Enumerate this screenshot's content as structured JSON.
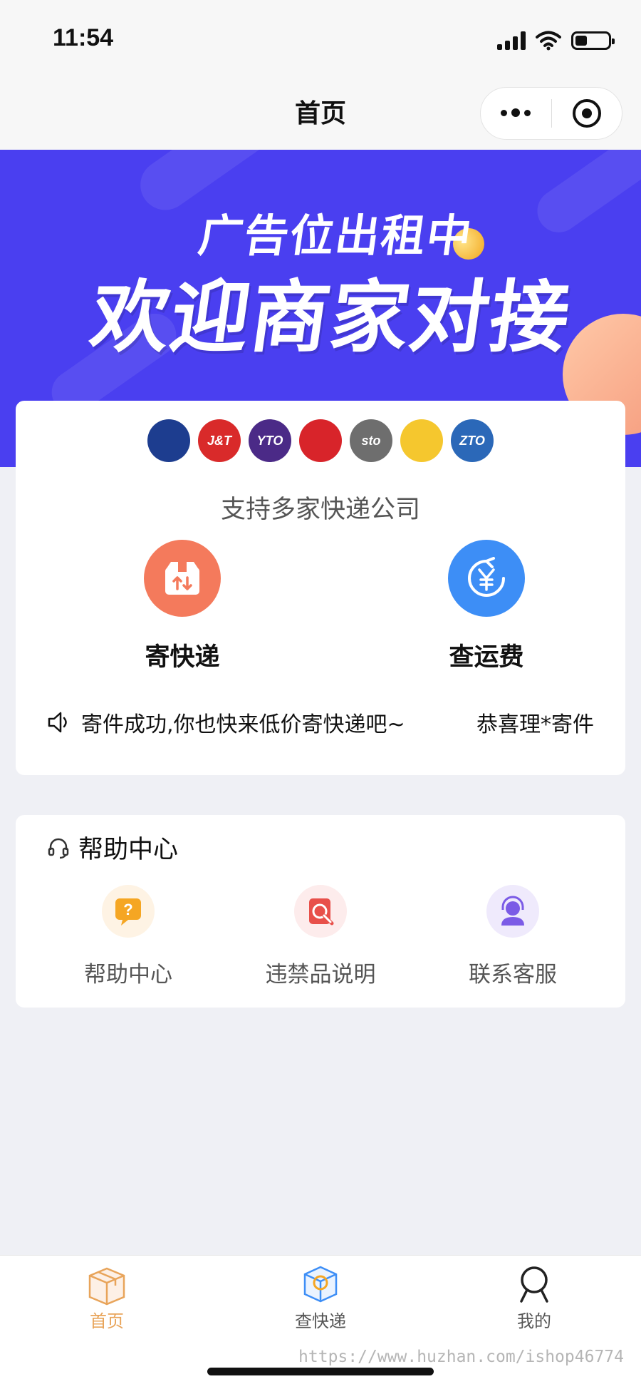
{
  "status_bar": {
    "time": "11:54"
  },
  "nav": {
    "title": "首页"
  },
  "banner": {
    "line1": "广告位出租中",
    "line2": "欢迎商家对接"
  },
  "carriers": {
    "logos": [
      {
        "name": "post-express",
        "text": "",
        "bg": "#1d3d8f"
      },
      {
        "name": "jt-express",
        "text": "J&T",
        "bg": "#d92a2a"
      },
      {
        "name": "yto-express",
        "text": "YTO",
        "bg": "#4b2a87"
      },
      {
        "name": "best-express",
        "text": "",
        "bg": "#d8242a"
      },
      {
        "name": "sto-express",
        "text": "sto",
        "bg": "#6e6e6e"
      },
      {
        "name": "yunda-express",
        "text": "",
        "bg": "#f5c72e"
      },
      {
        "name": "zto-express",
        "text": "ZTO",
        "bg": "#2b68b8"
      }
    ],
    "support_text": "支持多家快递公司"
  },
  "actions": {
    "send": {
      "label": "寄快递",
      "color": "#f47a5c"
    },
    "rate": {
      "label": "查运费",
      "color": "#3d8ef6"
    }
  },
  "ticker": {
    "text1": "寄件成功,你也快来低价寄快递吧~",
    "text2": "恭喜理*寄件"
  },
  "help": {
    "title": "帮助中心",
    "items": [
      {
        "label": "帮助中心",
        "color": "#f5a623"
      },
      {
        "label": "违禁品说明",
        "color": "#e8504a"
      },
      {
        "label": "联系客服",
        "color": "#7b5be6"
      }
    ]
  },
  "tabbar": {
    "tabs": [
      {
        "label": "首页",
        "active": true,
        "color": "#e8a45a"
      },
      {
        "label": "查快递",
        "active": false,
        "color": "#555555"
      },
      {
        "label": "我的",
        "active": false,
        "color": "#555555"
      }
    ]
  },
  "watermark": "https://www.huzhan.com/ishop46774"
}
